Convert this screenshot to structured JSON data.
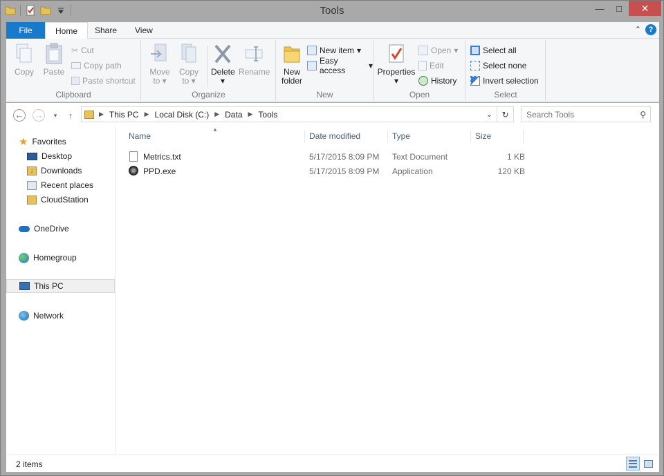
{
  "window": {
    "title": "Tools"
  },
  "quick_access": [
    {
      "name": "folder-icon"
    },
    {
      "name": "properties-icon"
    },
    {
      "name": "new-folder-icon"
    },
    {
      "name": "customize-dropdown-icon"
    }
  ],
  "tabs": [
    "File",
    "Home",
    "Share",
    "View"
  ],
  "ribbon": {
    "clipboard": {
      "label": "Clipboard",
      "copy": "Copy",
      "paste": "Paste",
      "cut": "Cut",
      "copy_path": "Copy path",
      "paste_shortcut": "Paste shortcut"
    },
    "organize": {
      "label": "Organize",
      "move_to_1": "Move",
      "move_to_2": "to",
      "copy_to_1": "Copy",
      "copy_to_2": "to",
      "delete": "Delete",
      "rename": "Rename"
    },
    "new": {
      "label": "New",
      "new_folder_1": "New",
      "new_folder_2": "folder",
      "new_item": "New item",
      "easy_access": "Easy access"
    },
    "open": {
      "label": "Open",
      "properties": "Properties",
      "open": "Open",
      "edit": "Edit",
      "history": "History"
    },
    "select": {
      "label": "Select",
      "select_all": "Select all",
      "select_none": "Select none",
      "invert_selection": "Invert selection"
    }
  },
  "address": {
    "crumbs": [
      "This PC",
      "Local Disk (C:)",
      "Data",
      "Tools"
    ],
    "search_placeholder": "Search Tools"
  },
  "nav": {
    "favorites": "Favorites",
    "desktop": "Desktop",
    "downloads": "Downloads",
    "recent": "Recent places",
    "cloudstation": "CloudStation",
    "onedrive": "OneDrive",
    "homegroup": "Homegroup",
    "thispc": "This PC",
    "network": "Network"
  },
  "columns": {
    "name": "Name",
    "date": "Date modified",
    "type": "Type",
    "size": "Size"
  },
  "files": [
    {
      "name": "Metrics.txt",
      "date": "5/17/2015 8:09 PM",
      "type": "Text Document",
      "size": "1 KB"
    },
    {
      "name": "PPD.exe",
      "date": "5/17/2015 8:09 PM",
      "type": "Application",
      "size": "120 KB"
    }
  ],
  "status": {
    "items": "2 items"
  },
  "colors": {
    "file_tab": "#1979ca",
    "close_button": "#c7504f",
    "column_header": "#4c607a"
  }
}
